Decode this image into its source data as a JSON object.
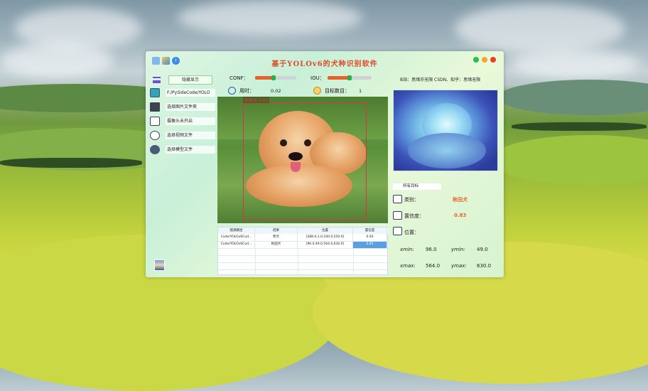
{
  "window": {
    "title": "基于YOLOv6的犬种识别软件"
  },
  "sidebar": {
    "hide_label": "隐藏显示",
    "items": [
      {
        "label": "F:/PySideCode/YOLO",
        "icon": "image-icon"
      },
      {
        "label": "选择图片文件夹",
        "icon": "folder-icon"
      },
      {
        "label": "摄像头未开启",
        "icon": "camera-icon"
      },
      {
        "label": "选择视频文件",
        "icon": "video-icon"
      },
      {
        "label": "选择模型文件",
        "icon": "model-icon"
      }
    ]
  },
  "controls": {
    "conf_label": "CONF：",
    "conf_value": 0.45,
    "iou_label": "IOU：",
    "iou_value": 0.5,
    "time_label": "用时：",
    "time_value": "0.02",
    "count_label": "目标数目：",
    "count_value": "1"
  },
  "detection": {
    "label": "秋田犬 0.83"
  },
  "author": {
    "text": "B站：思绪亦无限   CSDN、知乎：思绪无限"
  },
  "table": {
    "headers": [
      "图源路径",
      "结果",
      "位置",
      "置信度"
    ],
    "rows": [
      [
        "Code/YOLOv6Cod...",
        "柴犬",
        "[288.0,1.0,540.0,550.0]",
        "0.93"
      ],
      [
        "Code/YOLOv6Cod...",
        "秋田犬",
        "[96.0,49.0,564.0,630.0]",
        "0.83"
      ]
    ]
  },
  "info": {
    "target_select": "所有目标",
    "class_label": "类别：",
    "class_value": "秋田犬",
    "conf_label": "置信度：",
    "conf_value": "0.83",
    "pos_label": "位置：",
    "xmin_label": "xmin:",
    "xmin_value": "96.0",
    "ymin_label": "ymin:",
    "ymin_value": "49.0",
    "xmax_label": "xmax:",
    "xmax_value": "564.0",
    "ymax_label": "ymax:",
    "ymax_value": "630.0"
  }
}
